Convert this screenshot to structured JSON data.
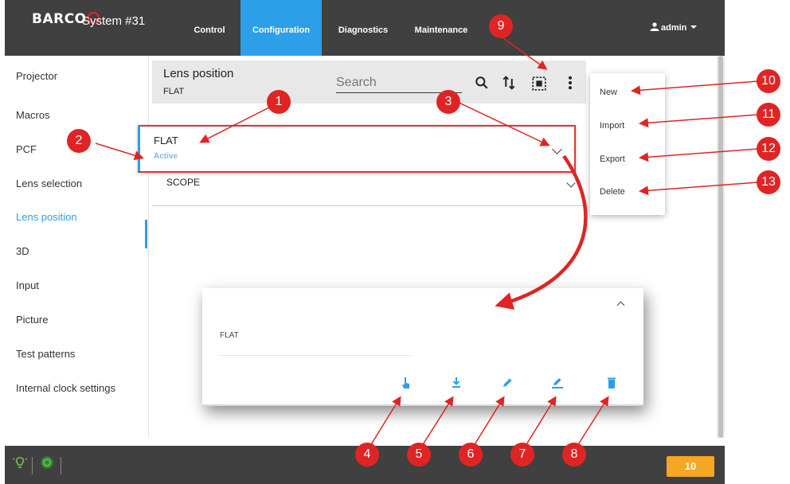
{
  "app": {
    "logo": "BARCO",
    "system_title": "System #31",
    "nav": [
      {
        "label": "Control"
      },
      {
        "label": "Configuration"
      },
      {
        "label": "Diagnostics"
      },
      {
        "label": "Maintenance"
      }
    ],
    "user": "admin"
  },
  "sidebar": {
    "items": [
      {
        "label": "Projector"
      },
      {
        "label": "Macros"
      },
      {
        "label": "PCF"
      },
      {
        "label": "Lens selection"
      },
      {
        "label": "Lens position"
      },
      {
        "label": "3D"
      },
      {
        "label": "Input"
      },
      {
        "label": "Picture"
      },
      {
        "label": "Test patterns"
      },
      {
        "label": "Internal clock settings"
      }
    ]
  },
  "header": {
    "title": "Lens position",
    "subtitle": "FLAT",
    "search_placeholder": "Search"
  },
  "list": {
    "selected": {
      "name": "FLAT",
      "status": "Active"
    },
    "second": {
      "name": "SCOPE"
    }
  },
  "menu": {
    "items": [
      "New",
      "Import",
      "Export",
      "Delete"
    ]
  },
  "expanded": {
    "name": "FLAT"
  },
  "footer": {
    "badge": "10"
  },
  "callouts": [
    "1",
    "2",
    "3",
    "4",
    "5",
    "6",
    "7",
    "8",
    "9",
    "10",
    "11",
    "12",
    "13"
  ],
  "colors": {
    "topbar": "#404040",
    "accent": "#2d9ee8",
    "callout": "#e02424",
    "highlight": "#d63a3a",
    "badge": "#f5a623"
  }
}
